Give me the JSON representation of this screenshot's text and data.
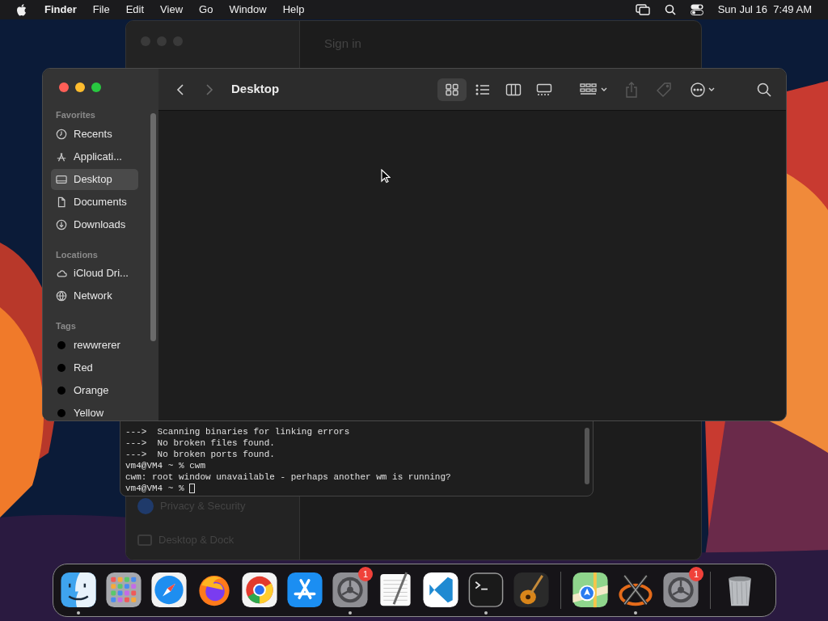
{
  "menu_bar": {
    "app": "Finder",
    "items": [
      "File",
      "Edit",
      "View",
      "Go",
      "Window",
      "Help"
    ],
    "clock": "Sun Jul 16  7:49 AM"
  },
  "settings_window": {
    "sign_in": "Sign in",
    "sidebar_items": [
      {
        "label": "Privacy & Security",
        "kind": "privacy"
      },
      {
        "label": "Desktop & Dock",
        "kind": "dock"
      }
    ]
  },
  "terminal": {
    "lines": [
      "--->  Scanning binaries for linking errors",
      "--->  No broken files found.",
      "--->  No broken ports found.",
      "vm4@VM4 ~ % cwm",
      "cwm: root window unavailable - perhaps another wm is running?"
    ],
    "prompt": "vm4@VM4 ~ %"
  },
  "finder": {
    "title": "Desktop",
    "view_modes": [
      {
        "kind": "icons",
        "selected": true
      },
      {
        "kind": "list",
        "selected": false
      },
      {
        "kind": "columns",
        "selected": false
      },
      {
        "kind": "gallery",
        "selected": false
      }
    ],
    "sidebar": [
      {
        "heading": "Favorites",
        "items": [
          {
            "label": "Recents",
            "kind": "clock",
            "selected": false
          },
          {
            "label": "Applicati...",
            "kind": "apps",
            "selected": false
          },
          {
            "label": "Desktop",
            "kind": "desktop",
            "selected": true
          },
          {
            "label": "Documents",
            "kind": "doc",
            "selected": false
          },
          {
            "label": "Downloads",
            "kind": "download",
            "selected": false
          }
        ]
      },
      {
        "heading": "Locations",
        "items": [
          {
            "label": "iCloud Dri...",
            "kind": "cloud",
            "selected": false
          },
          {
            "label": "Network",
            "kind": "globe",
            "selected": false
          }
        ]
      },
      {
        "heading": "Tags",
        "items": [
          {
            "label": "rewwrerer",
            "kind": "tag",
            "selected": false
          },
          {
            "label": "Red",
            "kind": "tag",
            "selected": false
          },
          {
            "label": "Orange",
            "kind": "tag",
            "selected": false
          },
          {
            "label": "Yellow",
            "kind": "tag",
            "selected": false
          }
        ]
      }
    ]
  },
  "dock": {
    "apps": [
      {
        "kind": "finder",
        "running": true
      },
      {
        "kind": "launchpad",
        "running": false
      },
      {
        "kind": "safari",
        "running": false
      },
      {
        "kind": "firefox",
        "running": false
      },
      {
        "kind": "chrome",
        "running": false
      },
      {
        "kind": "appstore",
        "running": false
      },
      {
        "kind": "settings",
        "running": true,
        "badge": "1"
      },
      {
        "kind": "textedit",
        "running": false
      },
      {
        "kind": "vscode",
        "running": false
      },
      {
        "kind": "terminal",
        "running": true
      },
      {
        "kind": "garageband",
        "running": false
      },
      {
        "kind": "separator"
      },
      {
        "kind": "maps",
        "running": false
      },
      {
        "kind": "xquartz",
        "running": true
      },
      {
        "kind": "settings",
        "running": false,
        "badge": "1"
      },
      {
        "kind": "separator"
      },
      {
        "kind": "trash",
        "running": false
      }
    ]
  }
}
